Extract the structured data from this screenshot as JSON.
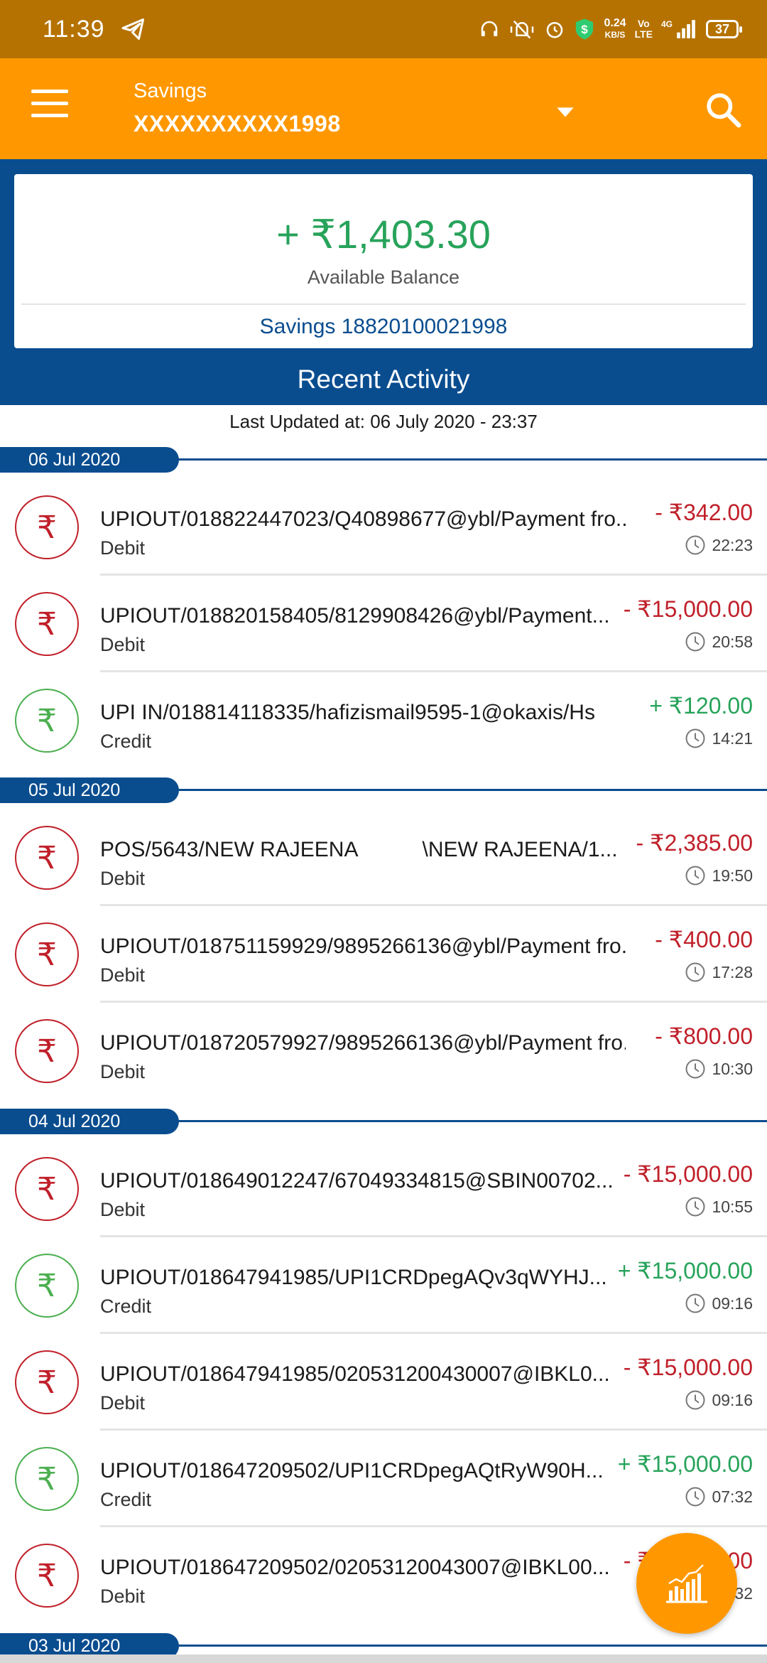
{
  "status_bar": {
    "time": "11:39",
    "speed": "0.24",
    "speed_unit": "KB/S",
    "volte_top": "Vo",
    "volte_bottom": "LTE",
    "network": "4G",
    "battery": "37"
  },
  "app_bar": {
    "account_type": "Savings",
    "account_number": "XXXXXXXXXX1998"
  },
  "balance": {
    "amount": "+ ₹1,403.30",
    "label": "Available Balance",
    "account": "Savings 18820100021998"
  },
  "recent": {
    "title": "Recent Activity",
    "last_updated": "Last Updated at: 06 July 2020 - 23:37"
  },
  "dates": [
    "06 Jul 2020",
    "05 Jul 2020",
    "04 Jul 2020",
    "03 Jul 2020"
  ],
  "transactions": [
    {
      "desc": "UPIOUT/018822447023/Q40898677@ybl/Payment fro...",
      "type": "Debit",
      "amount": "- ₹342.00",
      "time": "22:23",
      "kind": "debit"
    },
    {
      "desc": "UPIOUT/018820158405/8129908426@ybl/Payment...",
      "type": "Debit",
      "amount": "- ₹15,000.00",
      "time": "20:58",
      "kind": "debit"
    },
    {
      "desc": "UPI IN/018814118335/hafizismail9595-1@okaxis/Hs",
      "type": "Credit",
      "amount": "+ ₹120.00",
      "time": "14:21",
      "kind": "credit"
    },
    {
      "desc": "POS/5643/NEW RAJEENA           \\NEW RAJEENA/1...",
      "type": "Debit",
      "amount": "- ₹2,385.00",
      "time": "19:50",
      "kind": "debit"
    },
    {
      "desc": "UPIOUT/018751159929/9895266136@ybl/Payment fro...",
      "type": "Debit",
      "amount": "- ₹400.00",
      "time": "17:28",
      "kind": "debit"
    },
    {
      "desc": "UPIOUT/018720579927/9895266136@ybl/Payment fro...",
      "type": "Debit",
      "amount": "- ₹800.00",
      "time": "10:30",
      "kind": "debit"
    },
    {
      "desc": "UPIOUT/018649012247/67049334815@SBIN00702...",
      "type": "Debit",
      "amount": "- ₹15,000.00",
      "time": "10:55",
      "kind": "debit"
    },
    {
      "desc": "UPIOUT/018647941985/UPI1CRDpegAQv3qWYHJ...",
      "type": "Credit",
      "amount": "+ ₹15,000.00",
      "time": "09:16",
      "kind": "credit"
    },
    {
      "desc": "UPIOUT/018647941985/020531200430007@IBKL0...",
      "type": "Debit",
      "amount": "- ₹15,000.00",
      "time": "09:16",
      "kind": "debit"
    },
    {
      "desc": "UPIOUT/018647209502/UPI1CRDpegAQtRyW90H...",
      "type": "Credit",
      "amount": "+ ₹15,000.00",
      "time": "07:32",
      "kind": "credit"
    },
    {
      "desc": "UPIOUT/018647209502/02053120043007@IBKL00...",
      "type": "Debit",
      "amount": "- ₹15,000.00",
      "time": "07:32",
      "kind": "debit"
    }
  ],
  "rupee_symbol": "₹",
  "icons": {
    "menu": "hamburger-menu-icon",
    "dropdown": "caret-down-icon",
    "search": "search-icon",
    "clock": "clock-icon",
    "fab": "chart-icon"
  },
  "colors": {
    "status_bar": "#b57200",
    "app_bar": "#ff9800",
    "primary_blue": "#0a4d8f",
    "debit_red": "#c0202a",
    "credit_green": "#27a35a"
  }
}
